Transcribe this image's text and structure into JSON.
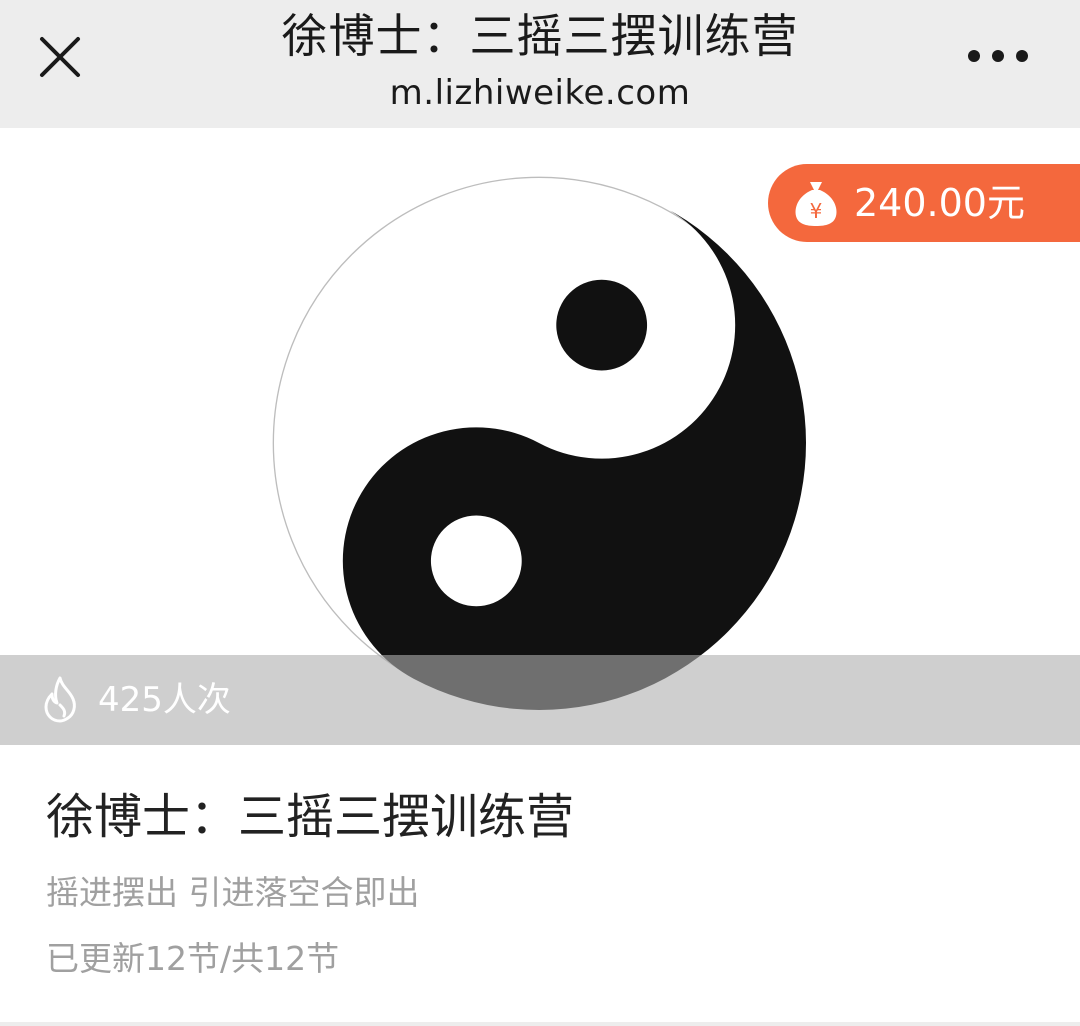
{
  "header": {
    "title": "徐博士：三摇三摆训练营",
    "domain": "m.lizhiweike.com",
    "close_icon": "close-icon",
    "more_icon": "more-horizontal-icon"
  },
  "hero": {
    "image": "yin-yang-symbol",
    "price": "240.00元",
    "price_icon": "money-bag-icon",
    "views": "425人次",
    "views_icon": "flame-icon"
  },
  "course": {
    "title": "徐博士：三摇三摆训练营",
    "subtitle": "摇进摆出 引进落空合即出",
    "progress": "已更新12节/共12节"
  },
  "colors": {
    "header_bg": "#ededed",
    "price_badge": "#f4683d",
    "muted_text": "#a0a0a0"
  }
}
